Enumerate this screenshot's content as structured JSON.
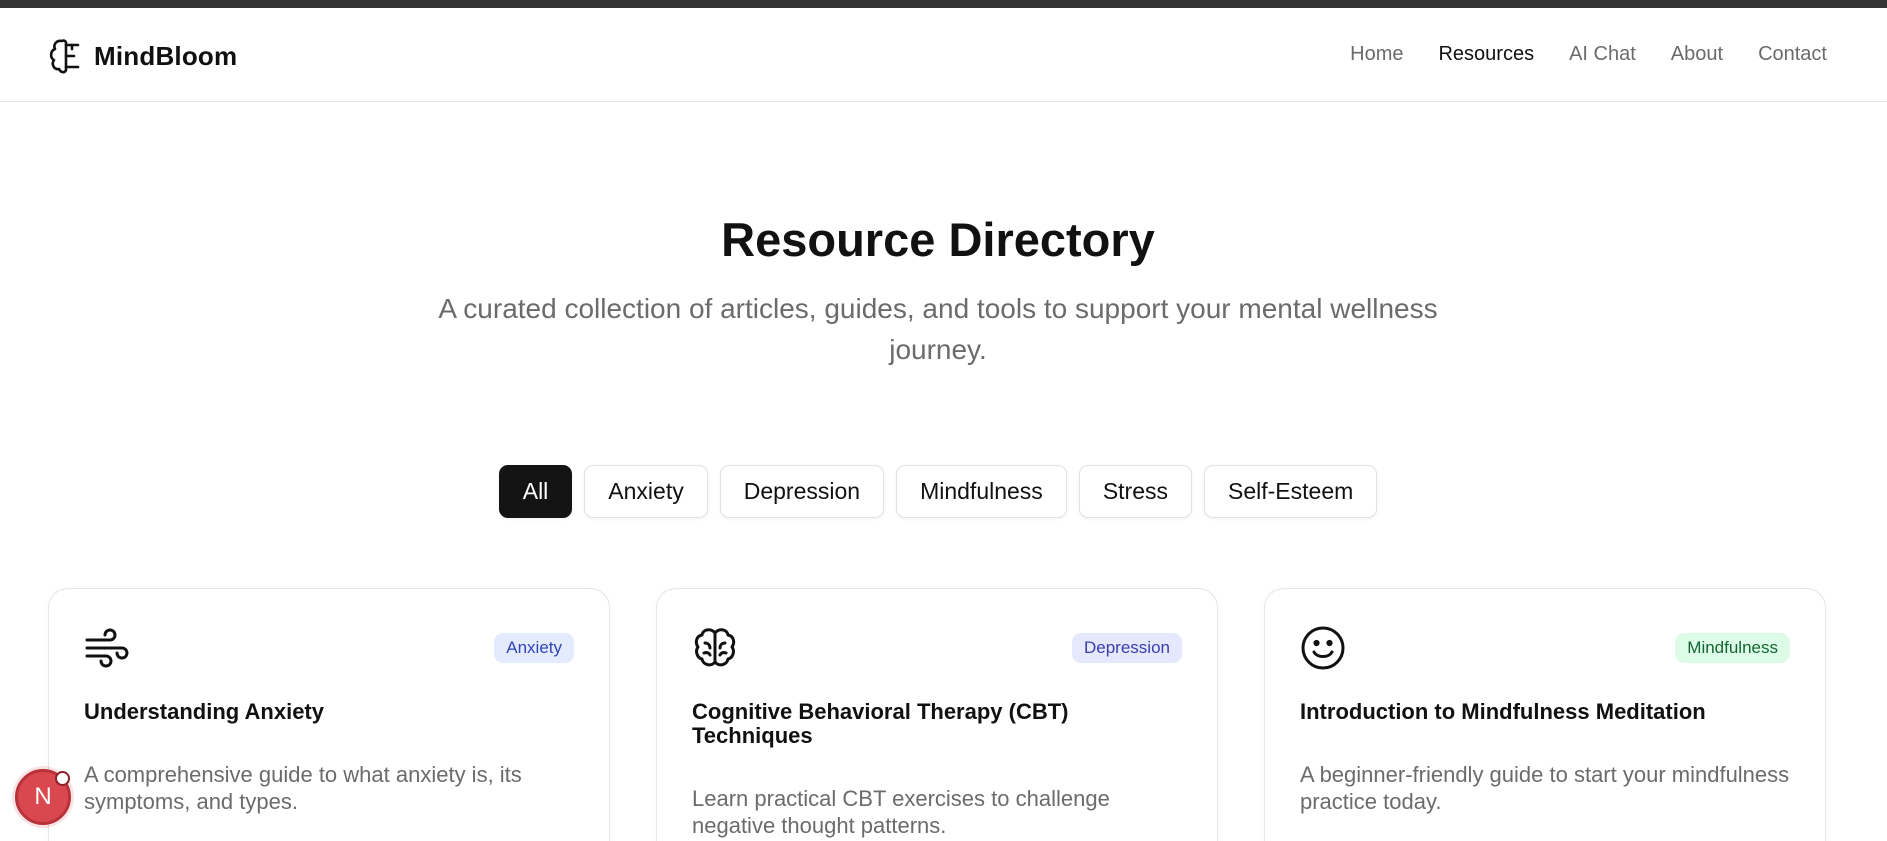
{
  "brand": {
    "name": "MindBloom",
    "icon": "brain-icon"
  },
  "nav": [
    {
      "label": "Home",
      "active": false
    },
    {
      "label": "Resources",
      "active": true
    },
    {
      "label": "AI Chat",
      "active": false
    },
    {
      "label": "About",
      "active": false
    },
    {
      "label": "Contact",
      "active": false
    }
  ],
  "hero": {
    "title": "Resource Directory",
    "subtitle": "A curated collection of articles, guides, and tools to support your mental wellness journey."
  },
  "filters": [
    {
      "label": "All",
      "active": true
    },
    {
      "label": "Anxiety",
      "active": false
    },
    {
      "label": "Depression",
      "active": false
    },
    {
      "label": "Mindfulness",
      "active": false
    },
    {
      "label": "Stress",
      "active": false
    },
    {
      "label": "Self-Esteem",
      "active": false
    }
  ],
  "cards": [
    {
      "icon": "wind-icon",
      "badge": "Anxiety",
      "badge_bg": "#e5ebff",
      "badge_color": "#2f45b5",
      "title": "Understanding Anxiety",
      "description": "A comprehensive guide to what anxiety is, its symptoms, and types."
    },
    {
      "icon": "brain-icon",
      "badge": "Depression",
      "badge_bg": "#e6e8ff",
      "badge_color": "#3a3ea8",
      "title": "Cognitive Behavioral Therapy (CBT) Techniques",
      "description": "Learn practical CBT exercises to challenge negative thought patterns."
    },
    {
      "icon": "smile-icon",
      "badge": "Mindfulness",
      "badge_bg": "#dcfce7",
      "badge_color": "#166534",
      "title": "Introduction to Mindfulness Meditation",
      "description": "A beginner-friendly guide to start your mindfulness practice today."
    }
  ],
  "fab": {
    "label": "N"
  },
  "colors": {
    "top_bar": "#333333",
    "active_chip": "#141414",
    "muted_text": "#6b6b6b",
    "fab": "#d9474f"
  }
}
